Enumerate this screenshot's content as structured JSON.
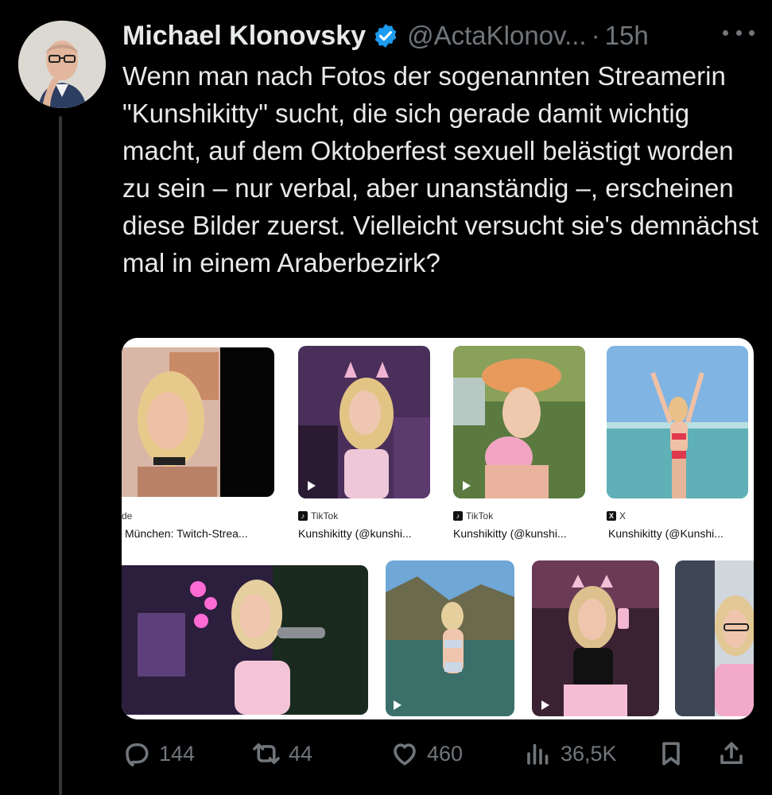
{
  "tweet": {
    "author_name": "Michael Klonovsky",
    "handle": "@ActaKlonov...",
    "separator": "·",
    "time": "15h",
    "text": "Wenn man nach Fotos der sogenannten Streamerin \"Kunshikitty\" sucht, die sich gerade damit wichtig macht, auf dem Oktoberfest sexuell belästigt worden zu sein – nur verbal, aber unanständig –, erscheinen diese Bilder zuerst. Vielleicht versucht sie's demnächst mal in einem Araberbezirk?"
  },
  "media": {
    "results": [
      {
        "source": "de",
        "caption": "München: Twitch-Strea..."
      },
      {
        "source": "TikTok",
        "caption": "Kunshikitty (@kunshi..."
      },
      {
        "source": "TikTok",
        "caption": "Kunshikitty (@kunshi..."
      },
      {
        "source": "X",
        "caption": "Kunshikitty (@Kunshi..."
      }
    ]
  },
  "actions": {
    "replies": "144",
    "reposts": "44",
    "likes": "460",
    "views": "36,5K"
  },
  "colors": {
    "background": "#000000",
    "text": "#e7e9ea",
    "muted": "#71767b",
    "verified": "#1d9bf0"
  }
}
